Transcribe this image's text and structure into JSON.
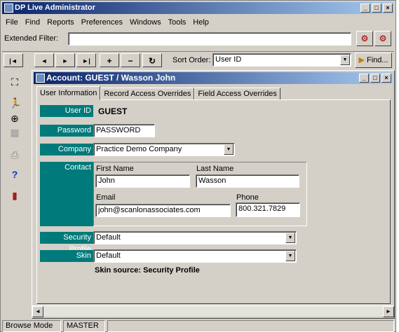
{
  "app": {
    "title": "DP Live Administrator"
  },
  "menu": [
    "File",
    "Find",
    "Reports",
    "Preferences",
    "Windows",
    "Tools",
    "Help"
  ],
  "filter": {
    "label": "Extended Filter:",
    "value": ""
  },
  "nav": {
    "first": "|◄",
    "prev": "◄",
    "next": "►",
    "last": "►|",
    "add": "+",
    "remove": "−",
    "refresh": "↻",
    "sort_label": "Sort Order:",
    "sort_value": "User ID",
    "find_label": "Find..."
  },
  "child": {
    "title": "Account: GUEST / Wasson John",
    "tabs": [
      "User Information",
      "Record Access Overrides",
      "Field Access Overrides"
    ],
    "form": {
      "userid_label": "User ID",
      "userid_value": "GUEST",
      "password_label": "Password",
      "password_value": "PASSWORD",
      "company_label": "Company",
      "company_value": "Practice Demo Company",
      "contact_label": "Contact",
      "first_name_label": "First Name",
      "first_name_value": "John",
      "last_name_label": "Last Name",
      "last_name_value": "Wasson",
      "email_label": "Email",
      "email_value": "john@scanlonassociates.com",
      "phone_label": "Phone",
      "phone_value": "800.321.7829",
      "security_label": "Security Profile",
      "security_value": "Default",
      "skin_label": "Skin",
      "skin_value": "Default",
      "skin_source": "Skin source: Security Profile"
    }
  },
  "status": {
    "mode": "Browse Mode",
    "user": "MASTER"
  },
  "colors": {
    "title_start": "#0a246a",
    "title_end": "#a6caf0",
    "label_teal": "#007a7a",
    "face": "#d4d0c8"
  }
}
